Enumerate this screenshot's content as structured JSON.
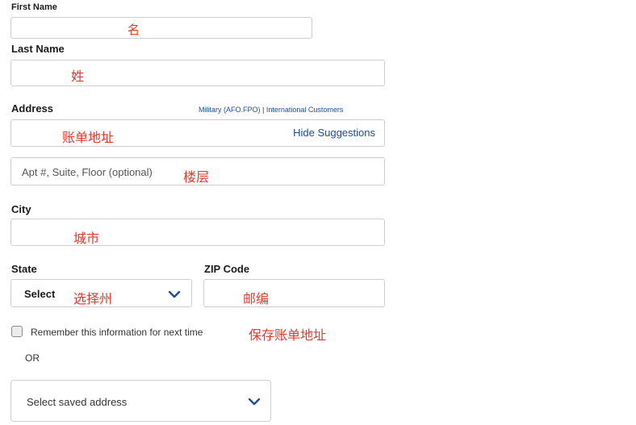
{
  "form": {
    "first_name": {
      "label": "First Name",
      "value": "",
      "annotation": "名"
    },
    "last_name": {
      "label": "Last Name",
      "value": "",
      "annotation": "姓"
    },
    "address": {
      "label": "Address",
      "links": {
        "military": "Military (AFO.FPO)",
        "separator": "|",
        "international": "International Customers"
      },
      "value": "",
      "hide_suggestions": "Hide Suggestions",
      "annotation": "账单地址"
    },
    "apt": {
      "placeholder": "Apt #, Suite, Floor (optional)",
      "annotation": "楼层"
    },
    "city": {
      "label": "City",
      "value": "",
      "annotation": "城市"
    },
    "state": {
      "label": "State",
      "selected": "Select",
      "annotation": "选择州",
      "icon": "chevron-down-icon"
    },
    "zip": {
      "label": "ZIP Code",
      "value": "",
      "annotation": "邮编"
    },
    "remember": {
      "label": "Remember this information for next time",
      "checked": false,
      "annotation": "保存账单地址"
    },
    "or_text": "OR",
    "saved_address": {
      "selected": "Select saved address",
      "icon": "chevron-down-icon"
    }
  },
  "colors": {
    "accent": "#1a4fa3",
    "annotation": "#e8392c",
    "border": "#cfcfcf"
  }
}
